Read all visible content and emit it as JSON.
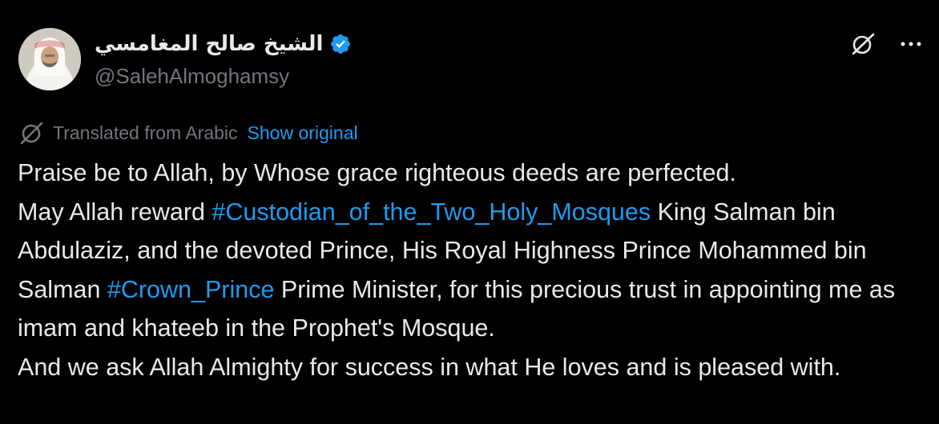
{
  "author": {
    "display_name": "الشيخ صالح المغامسي",
    "handle": "@SalehAlmoghamsy",
    "verified": true,
    "avatar_icon": "avatar-photo"
  },
  "actions": {
    "grok_icon": "grok-icon",
    "more_icon": "more-options-icon"
  },
  "translation": {
    "icon": "translate-icon",
    "label": "Translated from Arabic",
    "show_original": "Show original"
  },
  "tweet": {
    "line1": "Praise be to Allah, by Whose grace righteous deeds are perfected.",
    "line2_prefix": "May Allah reward ",
    "hashtag1": "#Custodian_of_the_Two_Holy_Mosques",
    "line2_suffix": " King Salman bin Abdulaziz, and the devoted Prince, His Royal Highness Prince Mohammed bin Salman ",
    "hashtag2": "#Crown_Prince",
    "line2_end": " Prime Minister, for this precious trust in appointing me as imam and khateeb in the Prophet's Mosque.",
    "line3": "And we ask Allah Almighty for success in what He loves and is pleased with."
  },
  "colors": {
    "background": "#000000",
    "text": "#e7e9ea",
    "secondary": "#71767b",
    "accent": "#1d9bf0"
  }
}
